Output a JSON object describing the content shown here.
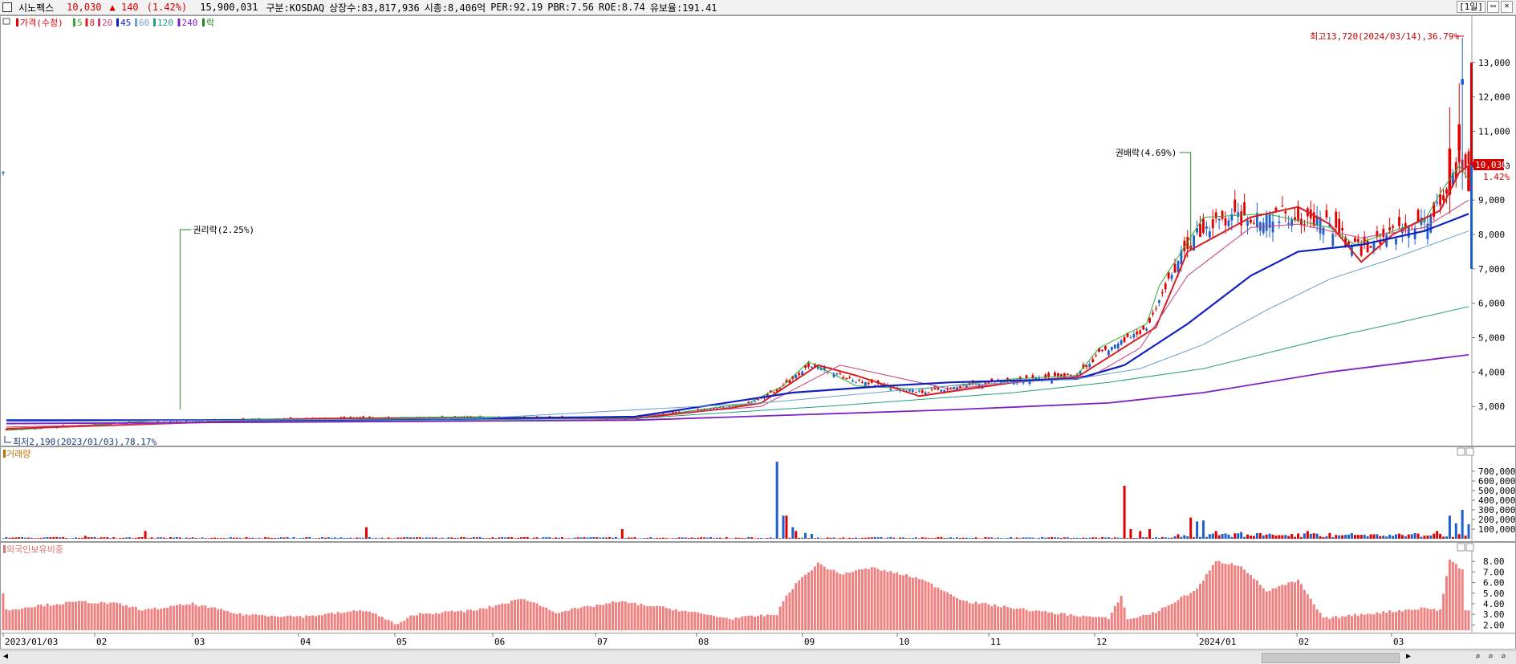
{
  "header": {
    "name": "시노펙스",
    "price": "10,030",
    "change": "▲ 140",
    "change_pct": "(1.42%)",
    "volume": "15,900,031",
    "market": "구분:KOSDAQ",
    "shares": "상장수:83,817,936",
    "mcap": "시총:8,406억",
    "per": "PER:92.19",
    "pbr": "PBR:7.56",
    "roe": "ROE:8.74",
    "reserve": "유보율:191.41",
    "period": "[1일]"
  },
  "colors": {
    "up": "#e00000",
    "down": "#1e5fcc",
    "ma5": "#33aa33",
    "ma8": "#d42020",
    "ma20": "#c8407a",
    "ma45": "#1020c0",
    "ma60": "#6a9fd0",
    "ma120": "#20a080",
    "ma240": "#8020c0",
    "foreign": "#f08080"
  },
  "legend": [
    {
      "label": "가격(수정)",
      "color": "#e00000"
    },
    {
      "label": "5",
      "color": "#33aa33"
    },
    {
      "label": "8",
      "color": "#d42020"
    },
    {
      "label": "20",
      "color": "#c8407a"
    },
    {
      "label": "45",
      "color": "#1020c0"
    },
    {
      "label": "60",
      "color": "#6a9fd0"
    },
    {
      "label": "120",
      "color": "#20a080"
    },
    {
      "label": "240",
      "color": "#8020c0"
    },
    {
      "label": "락",
      "color": "#228822"
    }
  ],
  "chart_data": [
    {
      "type": "candlestick",
      "title": "가격(수정)",
      "ylim": [
        2000,
        14000
      ],
      "yticks": [
        "3,000",
        "4,000",
        "5,000",
        "6,000",
        "7,000",
        "8,000",
        "9,000",
        "10,000",
        "11,000",
        "12,000",
        "13,000"
      ],
      "xlabels": [
        "2023/01/03",
        "02",
        "03",
        "04",
        "05",
        "06",
        "07",
        "08",
        "09",
        "10",
        "11",
        "12",
        "2024/01",
        "02",
        "03"
      ],
      "series": [
        {
          "name": "5",
          "points": [
            [
              1,
              2300
            ],
            [
              50,
              2600
            ],
            [
              150,
              2700
            ],
            [
              200,
              2650
            ],
            [
              228,
              3000
            ],
            [
              235,
              3050
            ],
            [
              247,
              3600
            ],
            [
              255,
              4300
            ],
            [
              270,
              3600
            ],
            [
              290,
              3500
            ],
            [
              320,
              3800
            ],
            [
              340,
              3900
            ],
            [
              347,
              4700
            ],
            [
              362,
              5400
            ],
            [
              366,
              6500
            ],
            [
              380,
              8500
            ],
            [
              400,
              8600
            ],
            [
              420,
              8200
            ],
            [
              428,
              7700
            ],
            [
              440,
              8100
            ],
            [
              450,
              8400
            ],
            [
              455,
              9200
            ],
            [
              461,
              10000
            ],
            [
              464,
              9600
            ]
          ]
        },
        {
          "name": "8",
          "points": [
            [
              1,
              2350
            ],
            [
              100,
              2650
            ],
            [
              200,
              2650
            ],
            [
              230,
              2950
            ],
            [
              240,
              3100
            ],
            [
              258,
              4200
            ],
            [
              270,
              3900
            ],
            [
              290,
              3300
            ],
            [
              320,
              3700
            ],
            [
              340,
              3850
            ],
            [
              346,
              4200
            ],
            [
              365,
              5300
            ],
            [
              375,
              7500
            ],
            [
              395,
              8500
            ],
            [
              410,
              8800
            ],
            [
              420,
              8300
            ],
            [
              430,
              7200
            ],
            [
              440,
              8000
            ],
            [
              455,
              8700
            ],
            [
              461,
              9800
            ],
            [
              464,
              10000
            ]
          ]
        },
        {
          "name": "20",
          "points": [
            [
              1,
              2400
            ],
            [
              100,
              2600
            ],
            [
              200,
              2700
            ],
            [
              240,
              3000
            ],
            [
              265,
              4200
            ],
            [
              280,
              3900
            ],
            [
              300,
              3500
            ],
            [
              330,
              3800
            ],
            [
              345,
              3900
            ],
            [
              360,
              4700
            ],
            [
              375,
              6800
            ],
            [
              395,
              8200
            ],
            [
              410,
              8300
            ],
            [
              430,
              7900
            ],
            [
              450,
              8200
            ],
            [
              464,
              9000
            ]
          ]
        },
        {
          "name": "45",
          "points": [
            [
              1,
              2600
            ],
            [
              100,
              2600
            ],
            [
              200,
              2700
            ],
            [
              250,
              3400
            ],
            [
              280,
              3600
            ],
            [
              300,
              3700
            ],
            [
              340,
              3800
            ],
            [
              355,
              4200
            ],
            [
              375,
              5400
            ],
            [
              395,
              6800
            ],
            [
              410,
              7500
            ],
            [
              430,
              7700
            ],
            [
              450,
              8100
            ],
            [
              464,
              8600
            ]
          ]
        },
        {
          "name": "60",
          "points": [
            [
              1,
              2550
            ],
            [
              150,
              2650
            ],
            [
              240,
              3100
            ],
            [
              300,
              3600
            ],
            [
              340,
              3800
            ],
            [
              360,
              4100
            ],
            [
              380,
              4800
            ],
            [
              400,
              5800
            ],
            [
              420,
              6700
            ],
            [
              440,
              7300
            ],
            [
              464,
              8100
            ]
          ]
        },
        {
          "name": "120",
          "points": [
            [
              1,
              2500
            ],
            [
              200,
              2650
            ],
            [
              260,
              3000
            ],
            [
              320,
              3400
            ],
            [
              350,
              3700
            ],
            [
              380,
              4100
            ],
            [
              420,
              5000
            ],
            [
              440,
              5400
            ],
            [
              464,
              5900
            ]
          ]
        },
        {
          "name": "240",
          "points": [
            [
              1,
              2500
            ],
            [
              200,
              2600
            ],
            [
              300,
              2900
            ],
            [
              350,
              3100
            ],
            [
              380,
              3400
            ],
            [
              420,
              4000
            ],
            [
              464,
              4500
            ]
          ]
        }
      ],
      "annotations": [
        {
          "text": "최고13,720(2024/03/14),36.79%",
          "value": 13720
        },
        {
          "text": "최저2,190(2023/01/03),78.17%",
          "value": 2190
        },
        {
          "text": "권리락(2.25%)"
        },
        {
          "text": "권배락(4.69%)"
        }
      ],
      "current_price": "10,030",
      "current_pct": "1.42%"
    },
    {
      "type": "bar",
      "title": "거래량",
      "yticks": [
        "100,000",
        "200,000",
        "300,000",
        "400,000",
        "500,000",
        "600,000",
        "700,000"
      ],
      "ylim": [
        0,
        800000
      ],
      "bars": [
        [
          26,
          30000
        ],
        [
          45,
          80000
        ],
        [
          115,
          120000
        ],
        [
          196,
          100000
        ],
        [
          245,
          800000
        ],
        [
          247,
          240000
        ],
        [
          248,
          240000
        ],
        [
          250,
          120000
        ],
        [
          251,
          80000
        ],
        [
          254,
          60000
        ],
        [
          256,
          50000
        ],
        [
          355,
          550000
        ],
        [
          357,
          100000
        ],
        [
          360,
          80000
        ],
        [
          363,
          100000
        ],
        [
          376,
          220000
        ],
        [
          378,
          180000
        ],
        [
          380,
          190000
        ],
        [
          384,
          80000
        ],
        [
          392,
          70000
        ],
        [
          413,
          80000
        ],
        [
          420,
          60000
        ],
        [
          454,
          80000
        ],
        [
          458,
          240000
        ],
        [
          460,
          160000
        ],
        [
          462,
          300000
        ],
        [
          464,
          150000
        ]
      ]
    },
    {
      "type": "bar",
      "title": "외국인보유비중",
      "ylim": [
        1.5,
        9
      ],
      "yticks": [
        "2.00",
        "3.00",
        "4.00",
        "5.00",
        "6.00",
        "7.00",
        "8.00"
      ],
      "anchors": [
        [
          0,
          5.0
        ],
        [
          1,
          3.4
        ],
        [
          10,
          3.8
        ],
        [
          25,
          4.2
        ],
        [
          36,
          4.0
        ],
        [
          45,
          3.4
        ],
        [
          60,
          4.0
        ],
        [
          75,
          3.0
        ],
        [
          95,
          2.8
        ],
        [
          115,
          3.4
        ],
        [
          125,
          2.0
        ],
        [
          130,
          3.0
        ],
        [
          150,
          3.4
        ],
        [
          165,
          4.5
        ],
        [
          175,
          3.2
        ],
        [
          195,
          4.2
        ],
        [
          210,
          3.6
        ],
        [
          230,
          2.6
        ],
        [
          245,
          3.0
        ],
        [
          248,
          4.8
        ],
        [
          252,
          6.2
        ],
        [
          258,
          7.8
        ],
        [
          265,
          6.8
        ],
        [
          275,
          7.4
        ],
        [
          290,
          6.4
        ],
        [
          305,
          4.2
        ],
        [
          330,
          3.2
        ],
        [
          350,
          2.6
        ],
        [
          354,
          4.8
        ],
        [
          356,
          2.5
        ],
        [
          365,
          3.2
        ],
        [
          378,
          5.4
        ],
        [
          384,
          8.0
        ],
        [
          392,
          7.6
        ],
        [
          400,
          5.2
        ],
        [
          410,
          6.2
        ],
        [
          418,
          2.6
        ],
        [
          430,
          3.0
        ],
        [
          450,
          3.6
        ],
        [
          455,
          3.4
        ],
        [
          458,
          8.2
        ],
        [
          462,
          7.2
        ],
        [
          463,
          3.4
        ]
      ]
    }
  ]
}
